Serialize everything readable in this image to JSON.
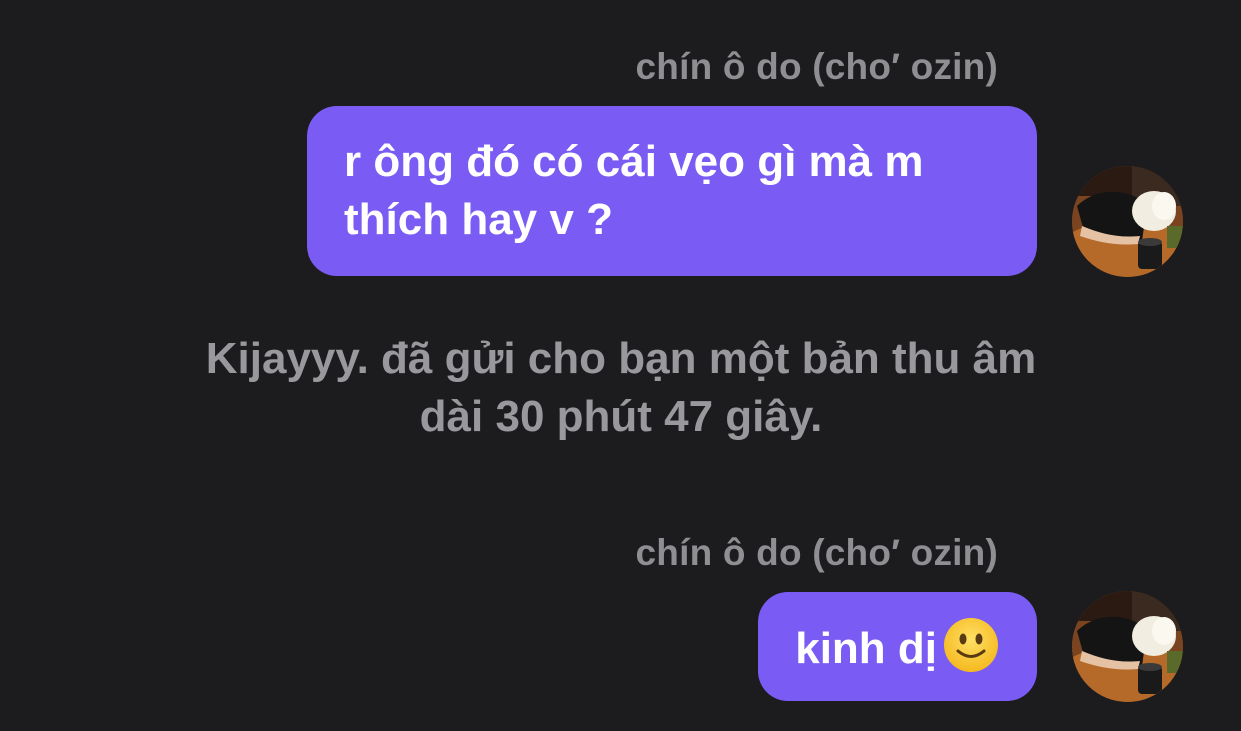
{
  "messages": [
    {
      "sender": "chín ô do (cho′ ozin)",
      "text_line1": "r ông đó có cái vẹo gì mà m",
      "text_line2": "thích hay v ?",
      "avatar_icon": "user-avatar-photo"
    },
    {
      "sender": "chín ô do (cho′ ozin)",
      "text": "kinh dị",
      "emoji": "slightly-smiling-face-icon",
      "avatar_icon": "user-avatar-photo"
    }
  ],
  "system_note": {
    "line1": "Kijayyy. đã gửi cho bạn một bản thu âm",
    "line2": "dài 30 phút 47 giây."
  },
  "colors": {
    "background": "#1c1c1e",
    "bubble": "#7a5cf5",
    "sender_name": "#8e8e93",
    "system_note": "#98989d"
  }
}
